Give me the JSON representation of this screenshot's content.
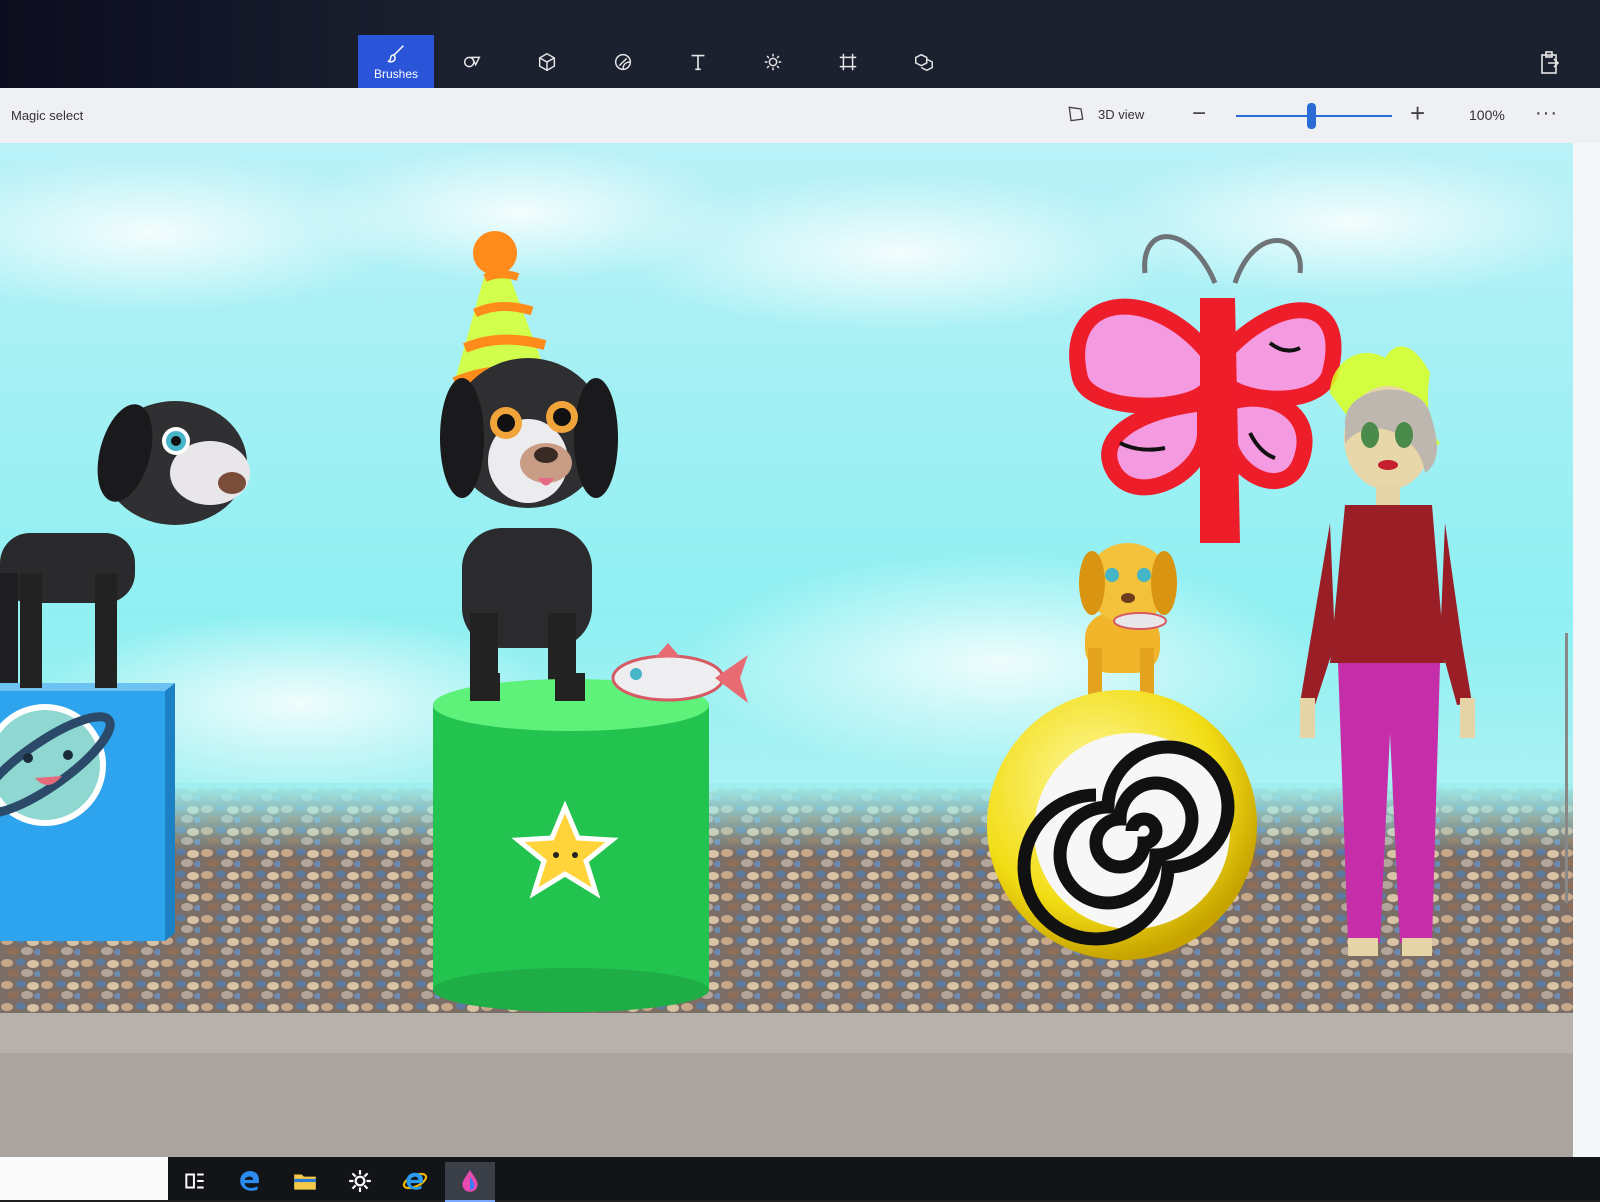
{
  "toolbar": {
    "tools": [
      {
        "id": "brushes",
        "label": "Brushes",
        "icon": "brush-icon",
        "active": true
      },
      {
        "id": "shapes2d",
        "label": "",
        "icon": "2d-shapes-icon"
      },
      {
        "id": "shapes3d",
        "label": "",
        "icon": "3d-shapes-icon"
      },
      {
        "id": "stickers",
        "label": "",
        "icon": "stickers-icon"
      },
      {
        "id": "text",
        "label": "",
        "icon": "text-icon"
      },
      {
        "id": "effects",
        "label": "",
        "icon": "effects-icon"
      },
      {
        "id": "canvas",
        "label": "",
        "icon": "canvas-icon"
      },
      {
        "id": "library",
        "label": "",
        "icon": "3d-library-icon"
      }
    ],
    "share_icon": "paste-icon",
    "accent": "#2a55d8"
  },
  "subbar": {
    "magic_select": "Magic select",
    "view_3d": "3D view",
    "zoom_value": "100%",
    "zoom_level": 0.49,
    "more": "···"
  },
  "taskbar": {
    "icons": [
      "task-view-icon",
      "edge-icon",
      "file-explorer-icon",
      "settings-icon",
      "internet-explorer-icon",
      "paint3d-icon"
    ]
  }
}
